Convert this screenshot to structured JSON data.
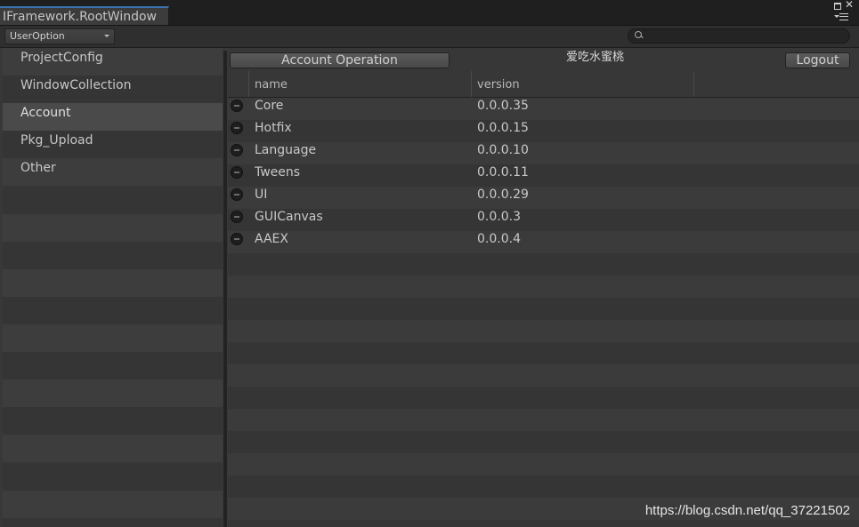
{
  "window": {
    "tab_title": "IFramework.RootWindow"
  },
  "toolbar": {
    "dropdown_value": "UserOption",
    "search_placeholder": ""
  },
  "sidebar": {
    "items": [
      {
        "label": "ProjectConfig"
      },
      {
        "label": "WindowCollection"
      },
      {
        "label": "Account",
        "selected": true
      },
      {
        "label": "Pkg_Upload"
      },
      {
        "label": "Other"
      }
    ]
  },
  "main": {
    "account_operation_label": "Account Operation",
    "username": "爱吃水蜜桃",
    "logout_label": "Logout",
    "columns": [
      "name",
      "version"
    ],
    "rows": [
      {
        "name": "Core",
        "version": "0.0.0.35"
      },
      {
        "name": "Hotfix",
        "version": "0.0.0.15"
      },
      {
        "name": "Language",
        "version": "0.0.0.10"
      },
      {
        "name": "Tweens",
        "version": "0.0.0.11"
      },
      {
        "name": "UI",
        "version": "0.0.0.29"
      },
      {
        "name": "GUICanvas",
        "version": "0.0.0.3"
      },
      {
        "name": "AAEX",
        "version": "0.0.0.4"
      }
    ]
  },
  "watermark": "https://blog.csdn.net/qq_37221502",
  "colors": {
    "accent": "#3a72b0",
    "background": "#383838"
  }
}
